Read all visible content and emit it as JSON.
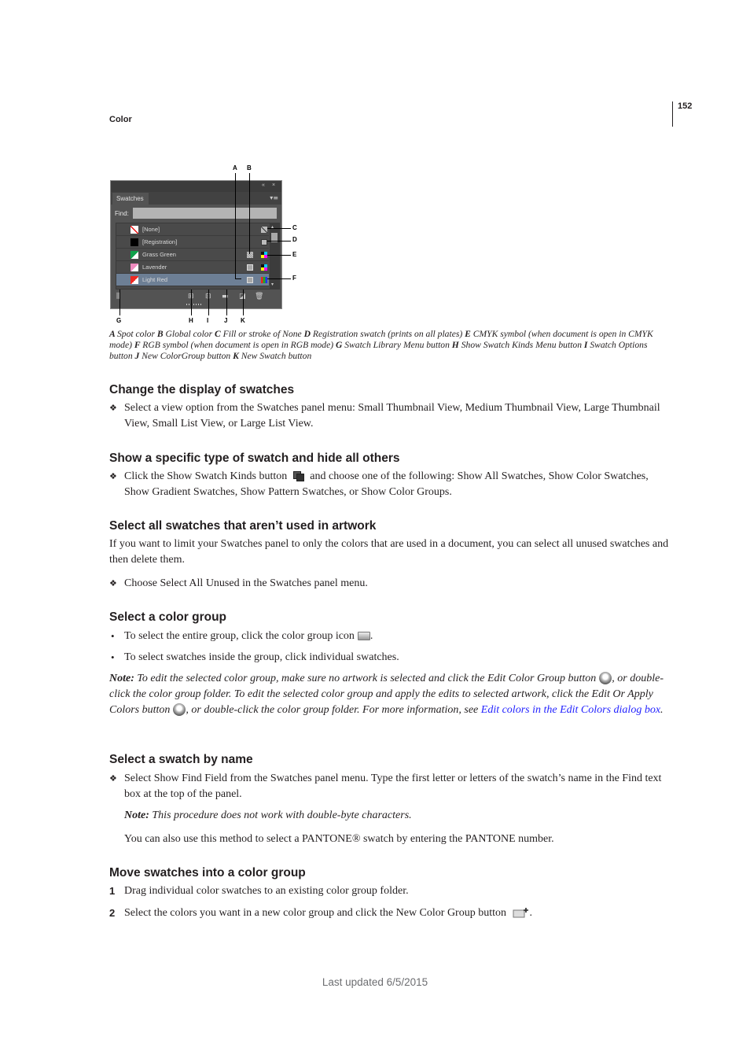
{
  "header": {
    "section": "Color",
    "page_number": "152"
  },
  "figure": {
    "panel": {
      "tab_label": "Swatches",
      "find_label": "Find:",
      "find_value": "",
      "collapse_glyph": "«",
      "close_glyph": "×",
      "menu_glyph": "▾≡",
      "swatches": [
        {
          "name": "[None]",
          "color": "#ffffff",
          "kind": "none",
          "mode": "none"
        },
        {
          "name": "[Registration]",
          "color": "#000000",
          "kind": "registration",
          "mode": "registration"
        },
        {
          "name": "Grass Green",
          "color": "#0fa04a",
          "kind": "global",
          "mode": "cmyk"
        },
        {
          "name": "Lavender",
          "color": "#f08cc0",
          "kind": "spot",
          "mode": "cmyk"
        },
        {
          "name": "Light Red",
          "color": "#ee2a24",
          "kind": "spot",
          "mode": "rgb",
          "selected": true
        }
      ],
      "bottom_icons": [
        "swatch-library-menu-icon",
        "show-swatch-kinds-icon",
        "swatch-options-icon",
        "new-color-group-icon",
        "new-swatch-icon",
        "delete-swatch-icon"
      ]
    },
    "callouts": [
      "A",
      "B",
      "C",
      "D",
      "E",
      "F",
      "G",
      "H",
      "I",
      "J",
      "K"
    ],
    "caption": [
      {
        "key": "A",
        "text": "Spot color"
      },
      {
        "key": "B",
        "text": "Global color"
      },
      {
        "key": "C",
        "text": "Fill or stroke of None"
      },
      {
        "key": "D",
        "text": "Registration swatch (prints on all plates)"
      },
      {
        "key": "E",
        "text": "CMYK symbol (when document is open in CMYK mode)"
      },
      {
        "key": "F",
        "text": "RGB symbol (when document is open in RGB mode)"
      },
      {
        "key": "G",
        "text": "Swatch Library Menu button"
      },
      {
        "key": "H",
        "text": "Show Swatch Kinds Menu button"
      },
      {
        "key": "I",
        "text": "Swatch Options button"
      },
      {
        "key": "J",
        "text": "New ColorGroup button"
      },
      {
        "key": "K",
        "text": "New Swatch button"
      }
    ]
  },
  "sections": {
    "display": {
      "heading": "Change the display of swatches",
      "step": "Select a view option from the Swatches panel menu: Small Thumbnail View, Medium Thumbnail View, Large Thumbnail View, Small List View, or Large List View."
    },
    "specific": {
      "heading": "Show a specific type of swatch and hide all others",
      "step_before": "Click the Show Swatch Kinds button",
      "step_after": "and choose one of the following: Show All Swatches, Show Color Swatches, Show Gradient Swatches, Show Pattern Swatches, or Show Color Groups."
    },
    "unused": {
      "heading": "Select all swatches that aren’t used in artwork",
      "intro": "If you want to limit your Swatches panel to only the colors that are used in a document, you can select all unused swatches and then delete them.",
      "step": "Choose Select All Unused in the Swatches panel menu."
    },
    "group": {
      "heading": "Select a color group",
      "bullet1": "To select the entire group, click the color group icon",
      "bullet2": "To select swatches inside the group, click individual swatches.",
      "note_label": "Note:",
      "note_part1": "To edit the selected color group, make sure no artwork is selected and click the Edit Color Group button",
      "note_part2": ", or double-click the color group folder. To edit the selected color group and apply the edits to selected artwork, click the Edit Or Apply Colors button",
      "note_part3": ", or double-click the color group folder. For more information, see",
      "note_link": "Edit colors in the Edit Colors dialog box",
      "note_end": "."
    },
    "byname": {
      "heading": "Select a swatch by name",
      "step": "Select Show Find Field from the Swatches panel menu. Type the first letter or letters of the swatch’s name in the Find text box at the top of the panel.",
      "note_label": "Note:",
      "note": "This procedure does not work with double-byte characters.",
      "extra": "You can also use this method to select a PANTONE® swatch by entering the PANTONE number."
    },
    "move": {
      "heading": "Move swatches into a color group",
      "steps": [
        {
          "num": "1",
          "text": "Drag individual color swatches to an existing color group folder."
        },
        {
          "num": "2",
          "text": "Select the colors you want in a new color group and click the New Color Group button"
        }
      ]
    }
  },
  "markers": {
    "diamond": "❖",
    "dot": "•"
  },
  "footer": "Last updated 6/5/2015"
}
